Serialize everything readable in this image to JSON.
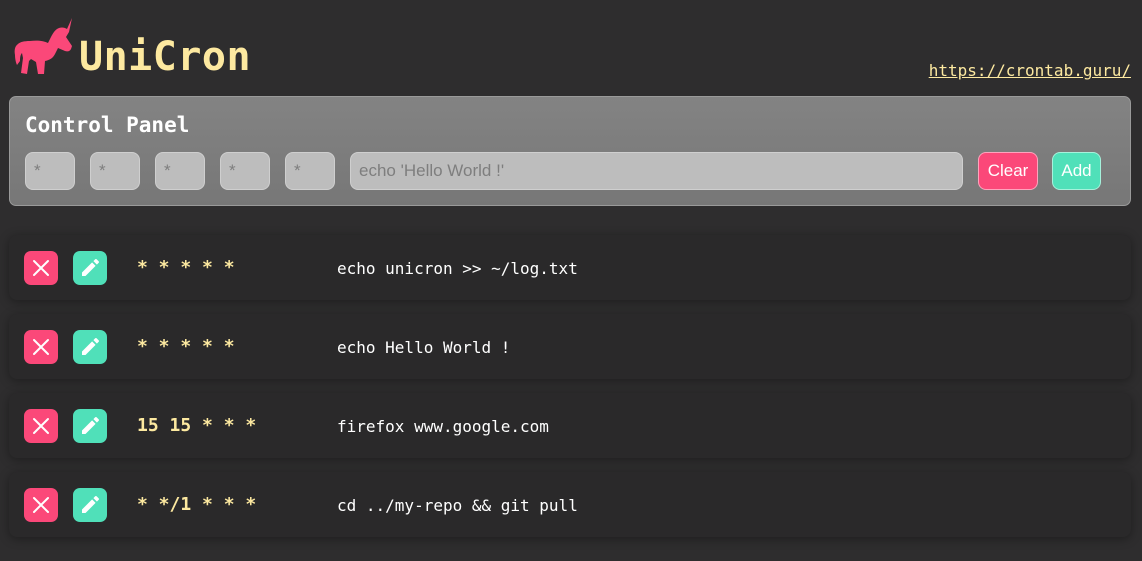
{
  "app": {
    "title": "UniCron",
    "link_text": "https://crontab.guru/"
  },
  "panel": {
    "title": "Control Panel",
    "fields": [
      {
        "placeholder": "*",
        "value": ""
      },
      {
        "placeholder": "*",
        "value": ""
      },
      {
        "placeholder": "*",
        "value": ""
      },
      {
        "placeholder": "*",
        "value": ""
      },
      {
        "placeholder": "*",
        "value": ""
      }
    ],
    "command_placeholder": "echo 'Hello World !'",
    "clear_label": "Clear",
    "add_label": "Add"
  },
  "jobs": [
    {
      "schedule": "* * * * *",
      "command": "echo unicron >> ~/log.txt"
    },
    {
      "schedule": "* * * * *",
      "command": "echo Hello World !"
    },
    {
      "schedule": "15 15 * * *",
      "command": "firefox www.google.com"
    },
    {
      "schedule": "* */1 * * *",
      "command": "cd ../my-repo && git pull"
    }
  ],
  "icons": {
    "logo": "unicorn-icon",
    "delete": "close-icon",
    "edit": "pencil-icon"
  },
  "colors": {
    "background": "#2e2d2e",
    "accent_yellow": "#fde9a0",
    "pink": "#fb4879",
    "mint": "#50e0b9",
    "panel": "#7d7d7d"
  }
}
